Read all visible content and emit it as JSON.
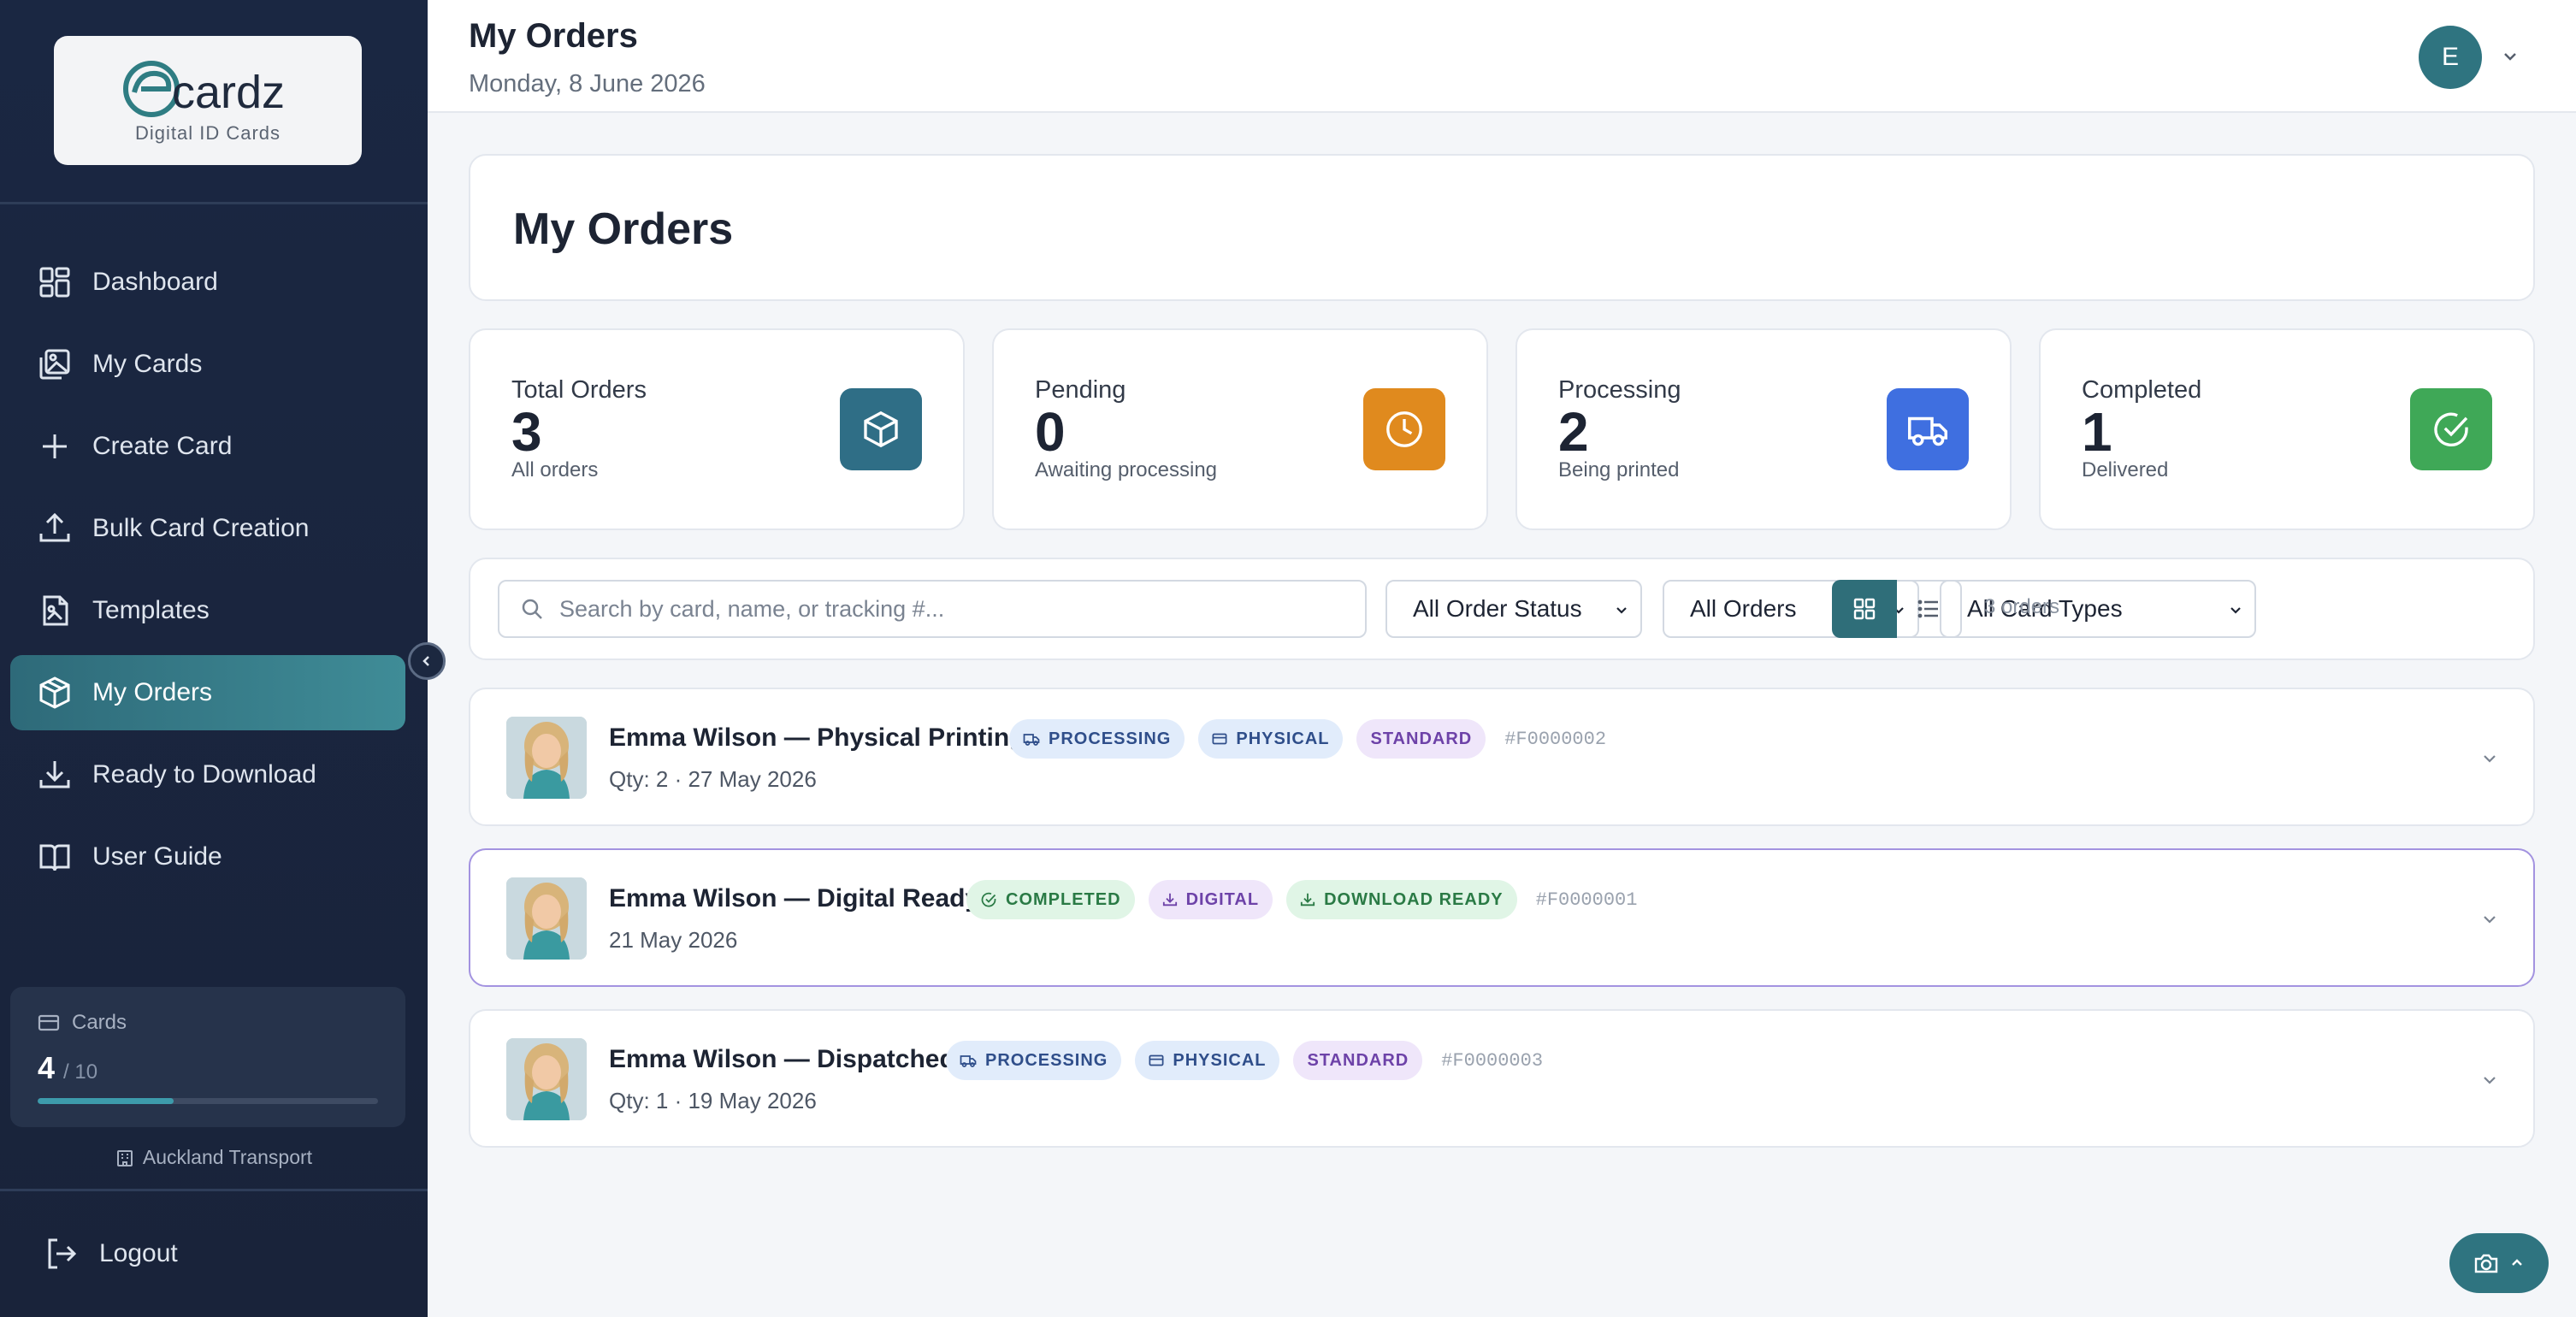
{
  "sidebar": {
    "logo": {
      "brand": "cardz",
      "tagline": "Digital ID Cards"
    },
    "nav": [
      {
        "label": "Dashboard",
        "icon": "dashboard-icon"
      },
      {
        "label": "My Cards",
        "icon": "cards-icon"
      },
      {
        "label": "Create Card",
        "icon": "plus-icon"
      },
      {
        "label": "Bulk Card Creation",
        "icon": "upload-icon"
      },
      {
        "label": "Templates",
        "icon": "template-icon"
      },
      {
        "label": "My Orders",
        "icon": "package-icon",
        "active": true
      },
      {
        "label": "Ready to Download",
        "icon": "download-icon"
      },
      {
        "label": "User Guide",
        "icon": "book-icon"
      }
    ],
    "usage": {
      "label": "Cards",
      "used": "4",
      "total": "/ 10",
      "fraction": 0.4
    },
    "organization": "Auckland Transport",
    "logout_label": "Logout"
  },
  "header": {
    "title": "My Orders",
    "date": "Monday, 8 June 2026",
    "avatar_initial": "E"
  },
  "main": {
    "page_title": "My Orders",
    "stats": [
      {
        "label": "Total Orders",
        "value": "3",
        "sub": "All orders",
        "icon": "package-icon",
        "color": "#2f6e86"
      },
      {
        "label": "Pending",
        "value": "0",
        "sub": "Awaiting processing",
        "icon": "clock-icon",
        "color": "#e08a1e"
      },
      {
        "label": "Processing",
        "value": "2",
        "sub": "Being printed",
        "icon": "truck-icon",
        "color": "#3f6fe0"
      },
      {
        "label": "Completed",
        "value": "1",
        "sub": "Delivered",
        "icon": "check-circle-icon",
        "color": "#3fa857"
      }
    ],
    "filters": {
      "search_placeholder": "Search by card, name, or tracking #...",
      "status_select": "All Order Status",
      "orders_select": "All Orders",
      "card_type_select": "All Card Types",
      "count_text": "3 orders"
    },
    "orders": [
      {
        "title": "Emma Wilson — Physical Printing",
        "meta": "Qty: 2 · 27 May 2026",
        "badges": [
          {
            "text": "PROCESSING",
            "style": "blue",
            "icon": "truck-icon"
          },
          {
            "text": "PHYSICAL",
            "style": "blue",
            "icon": "card-icon"
          },
          {
            "text": "STANDARD",
            "style": "purple",
            "icon": ""
          }
        ],
        "id": "#F0000002"
      },
      {
        "title": "Emma Wilson — Digital Ready",
        "meta": "21 May 2026",
        "badges": [
          {
            "text": "COMPLETED",
            "style": "green",
            "icon": "check-circle-icon"
          },
          {
            "text": "DIGITAL",
            "style": "purple",
            "icon": "download-icon"
          },
          {
            "text": "DOWNLOAD READY",
            "style": "green",
            "icon": "download-icon"
          }
        ],
        "id": "#F0000001"
      },
      {
        "title": "Emma Wilson — Dispatched",
        "meta": "Qty: 1 · 19 May 2026",
        "badges": [
          {
            "text": "PROCESSING",
            "style": "blue",
            "icon": "truck-icon"
          },
          {
            "text": "PHYSICAL",
            "style": "blue",
            "icon": "card-icon"
          },
          {
            "text": "STANDARD",
            "style": "purple",
            "icon": ""
          }
        ],
        "id": "#F0000003"
      }
    ]
  }
}
